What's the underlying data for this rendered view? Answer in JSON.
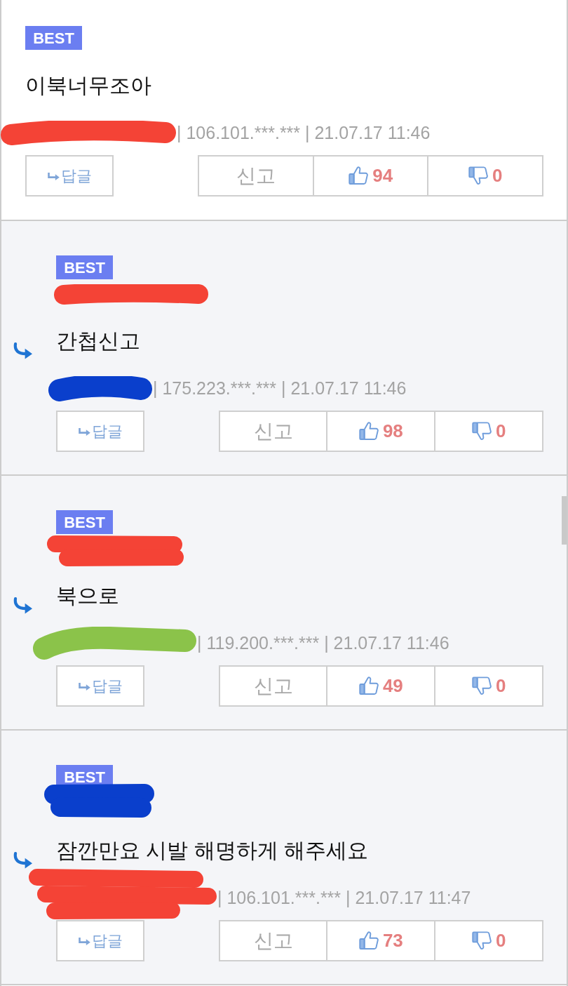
{
  "comments": [
    {
      "kind": "comment",
      "badge": "BEST",
      "text": "이북너무조아",
      "author_scribble": {
        "color": "#f44336"
      },
      "meta": "| 106.101.***.*** | 21.07.17 11:46",
      "reply_button": "답글",
      "report_button": "신고",
      "likes": "94",
      "dislikes": "0"
    },
    {
      "kind": "reply",
      "badge": "BEST",
      "mention_scribble": {
        "color": "#f44336"
      },
      "text": "간첩신고",
      "author_scribble": {
        "color": "#0a3fcc"
      },
      "meta": "| 175.223.***.*** | 21.07.17 11:46",
      "reply_button": "답글",
      "report_button": "신고",
      "likes": "98",
      "dislikes": "0"
    },
    {
      "kind": "reply",
      "badge": "BEST",
      "mention_scribble": {
        "color": "#f44336"
      },
      "text": "북으로",
      "author_scribble": {
        "color": "#8bc34a"
      },
      "meta": "| 119.200.***.*** | 21.07.17 11:46",
      "reply_button": "답글",
      "report_button": "신고",
      "likes": "49",
      "dislikes": "0"
    },
    {
      "kind": "reply",
      "badge": "BEST",
      "mention_scribble": {
        "color": "#0a3fcc"
      },
      "text": "잠깐만요 시발 해명하게 해주세요",
      "author_scribble": {
        "color": "#f44336"
      },
      "meta": "| 106.101.***.*** | 21.07.17 11:47",
      "reply_button": "답글",
      "report_button": "신고",
      "likes": "73",
      "dislikes": "0"
    }
  ]
}
